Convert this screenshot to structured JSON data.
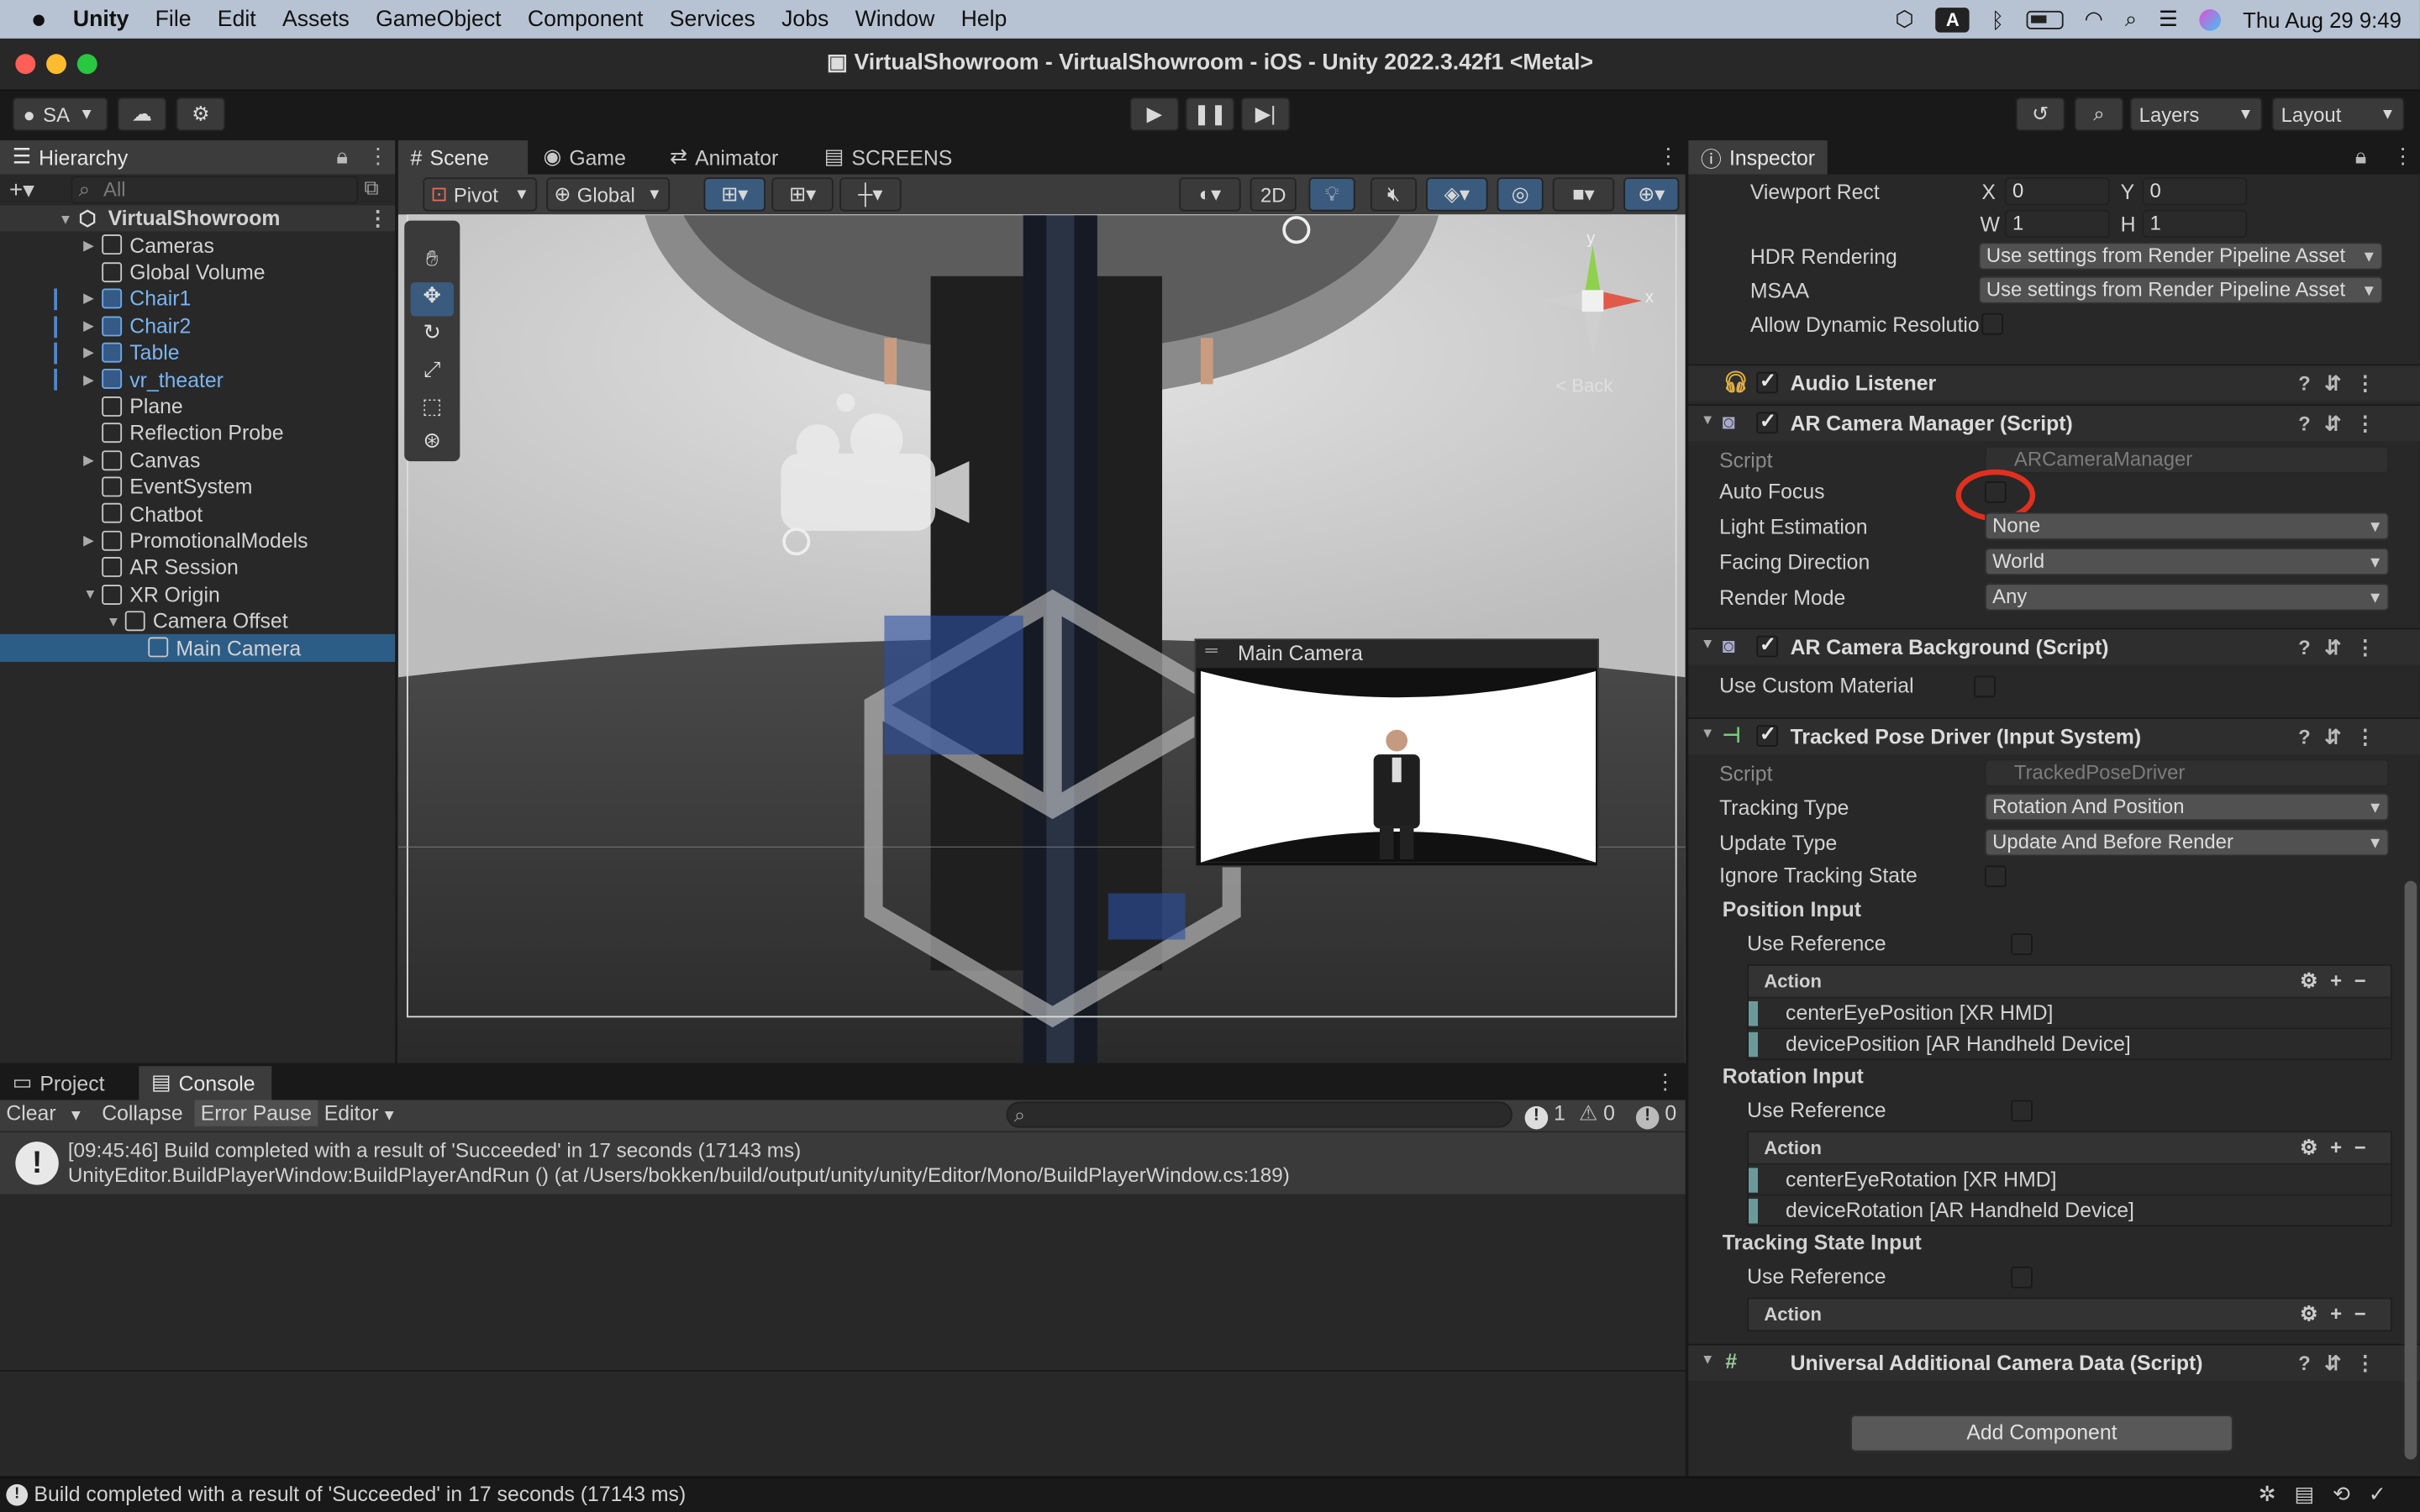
{
  "menubar": {
    "app": "Unity",
    "items": [
      "File",
      "Edit",
      "Assets",
      "GameObject",
      "Component",
      "Services",
      "Jobs",
      "Window",
      "Help"
    ],
    "clock": "Thu Aug 29  9:49",
    "input_badge": "A"
  },
  "window": {
    "title": "VirtualShowroom - VirtualShowroom - iOS - Unity 2022.3.42f1 <Metal>"
  },
  "toolbar": {
    "account": "SA",
    "layers": "Layers",
    "layout": "Layout"
  },
  "hierarchy": {
    "tab": "Hierarchy",
    "search_placeholder": "All",
    "scene": "VirtualShowroom",
    "items": [
      {
        "label": "Cameras",
        "expandable": true,
        "indent": 1
      },
      {
        "label": "Global Volume",
        "expandable": false,
        "indent": 1
      },
      {
        "label": "Chair1",
        "expandable": true,
        "indent": 1,
        "prefab": true
      },
      {
        "label": "Chair2",
        "expandable": true,
        "indent": 1,
        "prefab": true
      },
      {
        "label": "Table",
        "expandable": true,
        "indent": 1,
        "prefab": true
      },
      {
        "label": "vr_theater",
        "expandable": true,
        "indent": 1,
        "prefab": true
      },
      {
        "label": "Plane",
        "expandable": false,
        "indent": 1
      },
      {
        "label": "Reflection Probe",
        "expandable": false,
        "indent": 1
      },
      {
        "label": "Canvas",
        "expandable": true,
        "indent": 1
      },
      {
        "label": "EventSystem",
        "expandable": false,
        "indent": 1
      },
      {
        "label": "Chatbot",
        "expandable": false,
        "indent": 1
      },
      {
        "label": "PromotionalModels",
        "expandable": true,
        "indent": 1
      },
      {
        "label": "AR Session",
        "expandable": false,
        "indent": 1
      },
      {
        "label": "XR Origin",
        "expandable": true,
        "expanded": true,
        "indent": 1
      },
      {
        "label": "Camera Offset",
        "expandable": true,
        "expanded": true,
        "indent": 2
      },
      {
        "label": "Main Camera",
        "expandable": false,
        "indent": 3,
        "selected": true
      }
    ]
  },
  "scene_tabs": {
    "scene": "Scene",
    "game": "Game",
    "animator": "Animator",
    "screens": "SCREENS"
  },
  "scene_toolbar": {
    "pivot": "Pivot",
    "global": "Global",
    "mode_2d": "2D"
  },
  "gizmo": {
    "y": "y",
    "x": "x",
    "persp": "< Back"
  },
  "camera_preview": {
    "title": "Main Camera"
  },
  "console": {
    "tab_project": "Project",
    "tab_console": "Console",
    "clear": "Clear",
    "collapse": "Collapse",
    "error_pause": "Error Pause",
    "editor": "Editor",
    "count_log": "1",
    "count_warn": "0",
    "count_err": "0",
    "entry_line1": "[09:45:46] Build completed with a result of 'Succeeded' in 17 seconds (17143 ms)",
    "entry_line2": "UnityEditor.BuildPlayerWindow:BuildPlayerAndRun () (at /Users/bokken/build/output/unity/unity/Editor/Mono/BuildPlayerWindow.cs:189)"
  },
  "inspector": {
    "tab": "Inspector",
    "viewport_label": "Viewport Rect",
    "vx_label": "X",
    "vx": "0",
    "vy_label": "Y",
    "vy": "0",
    "vw_label": "W",
    "vw": "1",
    "vh_label": "H",
    "vh": "1",
    "hdr_label": "HDR Rendering",
    "hdr_value": "Use settings from Render Pipeline Asset",
    "msaa_label": "MSAA",
    "msaa_value": "Use settings from Render Pipeline Asset",
    "dyn_label": "Allow Dynamic Resolution",
    "audio_listener": "Audio Listener",
    "ar_cam_mgr": "AR Camera Manager (Script)",
    "script_label": "Script",
    "ar_cam_mgr_script": "ARCameraManager",
    "auto_focus_label": "Auto Focus",
    "light_est_label": "Light Estimation",
    "light_est_value": "None",
    "facing_label": "Facing Direction",
    "facing_value": "World",
    "render_mode_label": "Render Mode",
    "render_mode_value": "Any",
    "ar_cam_bg": "AR Camera Background (Script)",
    "custom_mat_label": "Use Custom Material",
    "tpd": "Tracked Pose Driver (Input System)",
    "tpd_script": "TrackedPoseDriver",
    "tracking_type_label": "Tracking Type",
    "tracking_type_value": "Rotation And Position",
    "update_type_label": "Update Type",
    "update_type_value": "Update And Before Render",
    "ignore_label": "Ignore Tracking State",
    "pos_input": "Position Input",
    "use_ref": "Use Reference",
    "action": "Action",
    "pos_actions": [
      "centerEyePosition [XR HMD]",
      "devicePosition [AR Handheld Device]"
    ],
    "rot_input": "Rotation Input",
    "rot_actions": [
      "centerEyeRotation [XR HMD]",
      "deviceRotation [AR Handheld Device]"
    ],
    "tracking_state_input": "Tracking State Input",
    "uacd": "Universal Additional Camera Data (Script)",
    "add_component": "Add Component"
  },
  "status": {
    "message": "Build completed with a result of 'Succeeded' in 17 seconds (17143 ms)"
  },
  "colors": {
    "selection": "#2c5d87",
    "highlight_circle": "#e0301e",
    "prefab_text": "#7ab4f0"
  }
}
